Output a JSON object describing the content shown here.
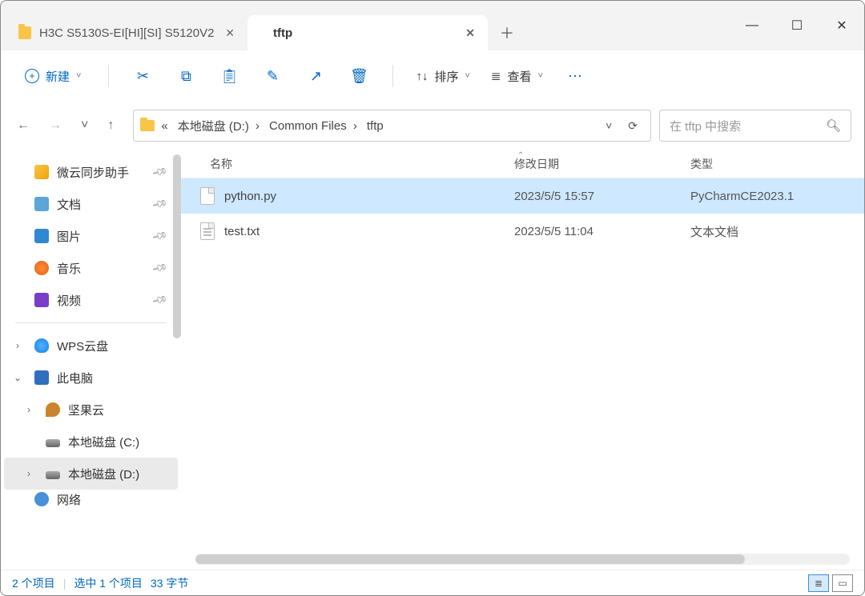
{
  "tabs": [
    {
      "label": "H3C S5130S-EI[HI][SI] S5120V2",
      "active": false
    },
    {
      "label": "tftp",
      "active": true
    }
  ],
  "toolbar": {
    "new_label": "新建",
    "sort_label": "排序",
    "view_label": "查看"
  },
  "breadcrumb": {
    "prefix": "«",
    "parts": [
      "本地磁盘 (D:)",
      "Common Files",
      "tftp"
    ]
  },
  "search": {
    "placeholder": "在 tftp 中搜索"
  },
  "sidebar": {
    "quick": [
      {
        "label": "微云同步助手",
        "iconcls": "sync",
        "pin": true
      },
      {
        "label": "文档",
        "iconcls": "doc",
        "pin": true
      },
      {
        "label": "图片",
        "iconcls": "pic",
        "pin": true
      },
      {
        "label": "音乐",
        "iconcls": "music",
        "pin": true
      },
      {
        "label": "视频",
        "iconcls": "video",
        "pin": true
      }
    ],
    "tree": [
      {
        "label": "WPS云盘",
        "iconcls": "cloud",
        "arrow": "›",
        "sub": false
      },
      {
        "label": "此电脑",
        "iconcls": "pc",
        "arrow": "⌄",
        "sub": false
      },
      {
        "label": "坚果云",
        "iconcls": "nut",
        "arrow": "›",
        "sub": true
      },
      {
        "label": "本地磁盘 (C:)",
        "iconcls": "drive",
        "arrow": "",
        "sub": true
      },
      {
        "label": "本地磁盘 (D:)",
        "iconcls": "drive",
        "arrow": "›",
        "sub": true,
        "selected": true
      },
      {
        "label": "网络",
        "iconcls": "net",
        "arrow": "",
        "sub": false,
        "cut": true
      }
    ]
  },
  "columns": {
    "name": "名称",
    "date": "修改日期",
    "type": "类型"
  },
  "files": [
    {
      "name": "python.py",
      "date": "2023/5/5 15:57",
      "type": "PyCharmCE2023.1",
      "selected": true,
      "iconcls": ""
    },
    {
      "name": "test.txt",
      "date": "2023/5/5 11:04",
      "type": "文本文档",
      "selected": false,
      "iconcls": "txt"
    }
  ],
  "status": {
    "count": "2 个项目",
    "selected": "选中 1 个项目",
    "size": "33 字节"
  }
}
